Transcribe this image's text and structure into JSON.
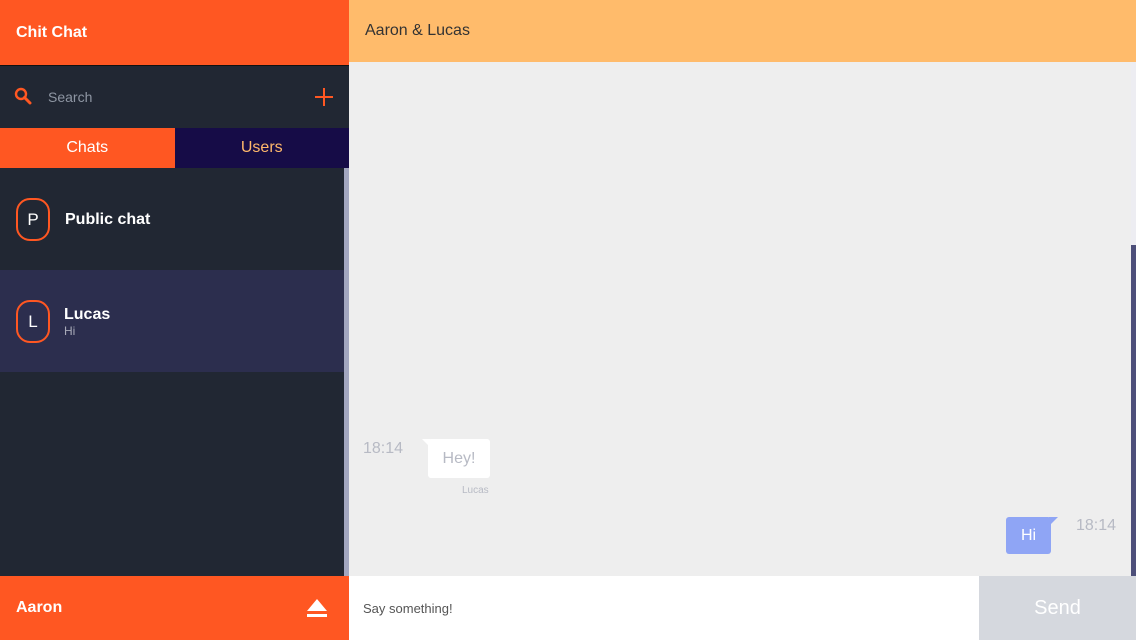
{
  "app": {
    "title": "Chit Chat"
  },
  "search": {
    "placeholder": "Search"
  },
  "tabs": [
    {
      "label": "Chats",
      "active": true
    },
    {
      "label": "Users",
      "active": false
    }
  ],
  "chats": [
    {
      "initial": "P",
      "name": "Public chat",
      "preview": ""
    },
    {
      "initial": "L",
      "name": "Lucas",
      "preview": "Hi",
      "selected": true
    }
  ],
  "current_user": {
    "name": "Aaron"
  },
  "conversation": {
    "title": "Aaron & Lucas",
    "messages": [
      {
        "direction": "incoming",
        "text": "Hey!",
        "time": "18:14",
        "sender": "Lucas"
      },
      {
        "direction": "outgoing",
        "text": "Hi",
        "time": "18:14"
      }
    ]
  },
  "composer": {
    "placeholder": "Say something!",
    "send_label": "Send"
  },
  "icons": {
    "search": "search-icon",
    "add": "plus-icon",
    "logout": "eject-icon"
  },
  "colors": {
    "accent": "#ff5722",
    "sidebar_bg": "#212733",
    "header_bg": "#ffbb6b",
    "tab_inactive_bg": "#160c47",
    "tab_inactive_text": "#ffb86b",
    "selected_item_bg": "#2c2e4e",
    "outgoing_bubble": "#8fa5f5",
    "send_button_bg": "#d5d8de"
  }
}
